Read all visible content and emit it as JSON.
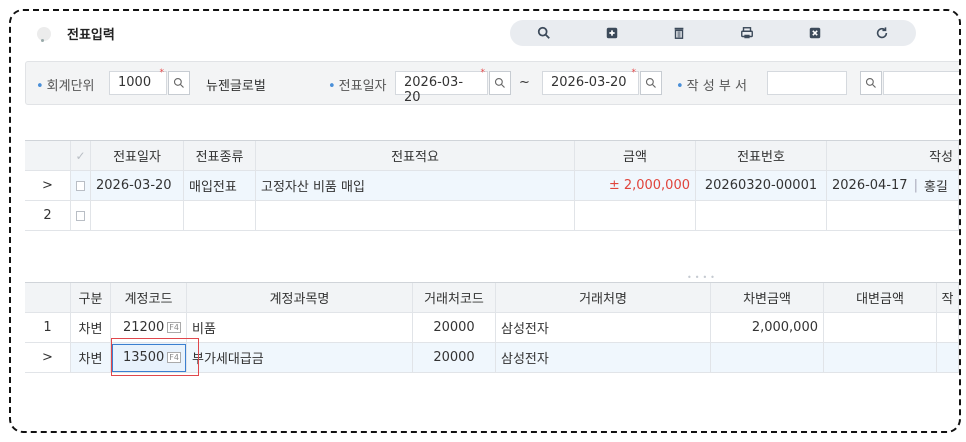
{
  "window": {
    "title": "전표입력"
  },
  "toolbar": {
    "buttons": [
      {
        "name": "search",
        "icon": "search-icon"
      },
      {
        "name": "add",
        "icon": "plus-square-icon"
      },
      {
        "name": "delete",
        "icon": "trash-icon"
      },
      {
        "name": "print",
        "icon": "printer-icon"
      },
      {
        "name": "close",
        "icon": "close-square-icon"
      },
      {
        "name": "refresh",
        "icon": "refresh-icon"
      }
    ]
  },
  "search": {
    "unit_label": "회계단위",
    "unit_code": "1000",
    "unit_name": "뉴젠글로벌",
    "date_label": "전표일자",
    "date_from": "2026-03-20",
    "date_tilde": "~",
    "date_to": "2026-03-20",
    "dept_label": "작 성 부 서",
    "dept_value": ""
  },
  "voucher_grid": {
    "headers": [
      "✓",
      "전표일자",
      "전표종류",
      "전표적요",
      "금액",
      "전표번호",
      "작성"
    ],
    "rows": [
      {
        "marker": ">",
        "date": "2026-03-20",
        "type": "매입전표",
        "summary": "고정자산 비품 매입",
        "amount": "± 2,000,000",
        "number": "20260320-00001",
        "created": "2026-04-17",
        "writer": "홍길"
      },
      {
        "marker": "2",
        "date": "",
        "type": "",
        "summary": "",
        "amount": "",
        "number": "",
        "created": "",
        "writer": ""
      }
    ]
  },
  "detail_grid": {
    "headers": [
      "구분",
      "계정코드",
      "계정과목명",
      "거래처코드",
      "거래처명",
      "차변금액",
      "대변금액",
      "작"
    ],
    "rows": [
      {
        "marker": "1",
        "side": "차변",
        "account_code": "21200",
        "account_name": "비품",
        "vendor_code": "20000",
        "vendor_name": "삼성전자",
        "debit": "2,000,000",
        "credit": ""
      },
      {
        "marker": ">",
        "side": "차변",
        "account_code": "13500",
        "account_name": "부가세대급금",
        "vendor_code": "20000",
        "vendor_name": "삼성전자",
        "debit": "",
        "credit": ""
      }
    ],
    "f4_label": "F4"
  },
  "colors": {
    "accent": "#3b7fd0",
    "required": "#e94a4a",
    "highlight_box": "#e0474c"
  }
}
